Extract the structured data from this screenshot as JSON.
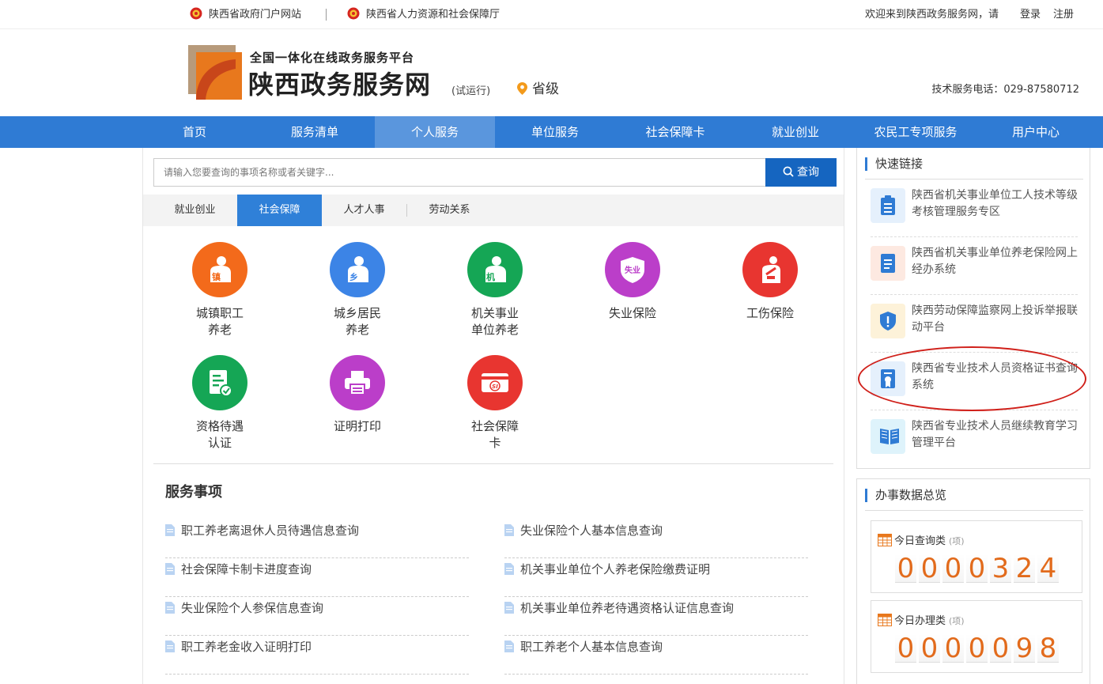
{
  "topbar": {
    "links": [
      "陕西省政府门户网站",
      "陕西省人力资源和社会保障厅"
    ],
    "welcome": "欢迎来到陕西政务服务网，请",
    "login": "登录",
    "register": "注册"
  },
  "header": {
    "slogan": "全国一体化在线政务服务平台",
    "site_name": "陕西政务服务网",
    "trial": "(试运行)",
    "level": "省级",
    "phone": "技术服务电话：029-87580712"
  },
  "nav": [
    "首页",
    "服务清单",
    "个人服务",
    "单位服务",
    "社会保障卡",
    "就业创业",
    "农民工专项服务",
    "用户中心"
  ],
  "search": {
    "placeholder": "请输入您要查询的事项名称或者关键字...",
    "button": "查询"
  },
  "tabs": [
    "就业创业",
    "社会保障",
    "人才人事",
    "劳动关系"
  ],
  "services": [
    {
      "label": "城镇职工\n养老",
      "glyph": "镇",
      "color": "#f36a1b"
    },
    {
      "label": "城乡居民\n养老",
      "glyph": "乡",
      "color": "#3c84e6"
    },
    {
      "label": "机关事业\n单位养老",
      "glyph": "机",
      "color": "#15a655"
    },
    {
      "label": "失业保险",
      "glyph": "失业",
      "color": "#bb3ec9"
    },
    {
      "label": "工伤保险",
      "color": "#e83530"
    },
    {
      "label": "资格待遇\n认证",
      "color": "#15a655"
    },
    {
      "label": "证明打印",
      "color": "#bb3ec9"
    },
    {
      "label": "社会保障\n卡",
      "glyph": "SI",
      "color": "#e83530"
    }
  ],
  "service_section": {
    "title": "服务事项",
    "left": [
      "职工养老离退休人员待遇信息查询",
      "社会保障卡制卡进度查询",
      "失业保险个人参保信息查询",
      "职工养老金收入证明打印"
    ],
    "right": [
      "失业保险个人基本信息查询",
      "机关事业单位个人养老保险缴费证明",
      "机关事业单位养老待遇资格认证信息查询",
      "职工养老个人基本信息查询"
    ]
  },
  "quick_links": {
    "title": "快速链接",
    "items": [
      {
        "text": "陕西省机关事业单位工人技术等级考核管理服务专区",
        "bg": "#e5f0fc",
        "fg": "#2f7bd4"
      },
      {
        "text": "陕西省机关事业单位养老保险网上经办系统",
        "bg": "#fde9e1",
        "fg": "#2f7bd4"
      },
      {
        "text": "陕西劳动保障监察网上投诉举报联动平台",
        "bg": "#fdf2d9",
        "fg": "#2f7bd4"
      },
      {
        "text": "陕西省专业技术人员资格证书查询系统",
        "bg": "#e5f0fc",
        "fg": "#2f7bd4"
      },
      {
        "text": "陕西省专业技术人员继续教育学习管理平台",
        "bg": "#def3fb",
        "fg": "#2f7bd4"
      }
    ]
  },
  "stats": {
    "title": "办事数据总览",
    "query": {
      "label": "今日查询类",
      "unit": "(项)",
      "digits": [
        "0",
        "0",
        "0",
        "0",
        "3",
        "2",
        "4"
      ]
    },
    "handle": {
      "label": "今日办理类",
      "unit": "(项)",
      "digits": [
        "0",
        "0",
        "0",
        "0",
        "0",
        "9",
        "8"
      ]
    }
  },
  "colors": {
    "primary": "#2f7bd4",
    "button": "#1565c0",
    "digit": "#e26b1c",
    "annotation": "#d0201a"
  }
}
